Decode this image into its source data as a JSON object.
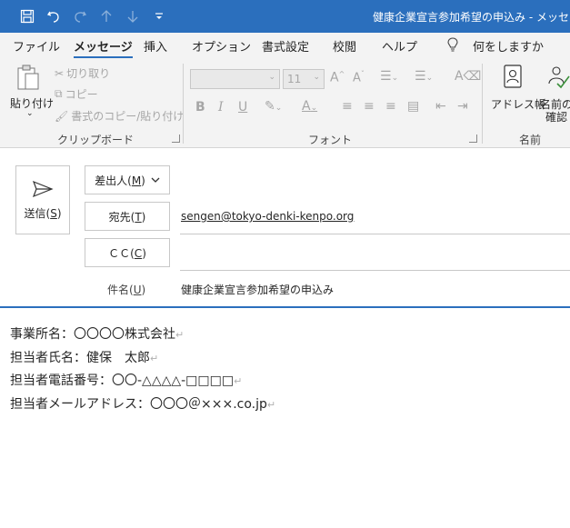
{
  "titlebar": {
    "title": "健康企業宣言参加希望の申込み  -  メッセー",
    "icons": [
      "save-icon",
      "undo-icon",
      "redo-icon",
      "up-arrow-icon",
      "down-arrow-icon",
      "customize-icon"
    ],
    "bg": "#2b6fbd"
  },
  "menu": {
    "items": [
      "ファイル",
      "メッセージ",
      "挿入",
      "オプション",
      "書式設定",
      "校閲",
      "ヘルプ"
    ],
    "active": "メッセージ",
    "search_label": "何をしますか"
  },
  "ribbon": {
    "clipboard": {
      "paste_label": "貼り付け",
      "cut_label": "切り取り",
      "copy_label": "コピー",
      "format_painter_label": "書式のコピー/貼り付け",
      "group_label": "クリップボード"
    },
    "font": {
      "font_name": "",
      "font_size": "11",
      "group_label": "フォント"
    },
    "names": {
      "address_book_label": "アドレス帳",
      "check_names_label_1": "名前の",
      "check_names_label_2": "確認",
      "group_label": "名前"
    }
  },
  "compose": {
    "send_label": "送信(",
    "send_key": "S",
    "send_close": ")",
    "from_label": "差出人(",
    "from_key": "M",
    "from_close": ")",
    "to_label": "宛先(",
    "to_key": "T",
    "to_close": ")",
    "to_value": "sengen@tokyo-denki-kenpo.org",
    "cc_label": "ＣＣ(",
    "cc_key": "C",
    "cc_close": ")",
    "cc_value": "",
    "subject_label": "件名(",
    "subject_key": "U",
    "subject_close": ")",
    "subject_value": "健康企業宣言参加希望の申込み"
  },
  "body": {
    "lines": [
      "事業所名：〇〇〇〇株式会社",
      "担当者氏名：健保　太郎",
      "担当者電話番号：〇〇-△△△△-□□□□",
      "担当者メールアドレス：〇〇〇＠×××.co.jp"
    ],
    "paragraph_mark": "↵"
  }
}
